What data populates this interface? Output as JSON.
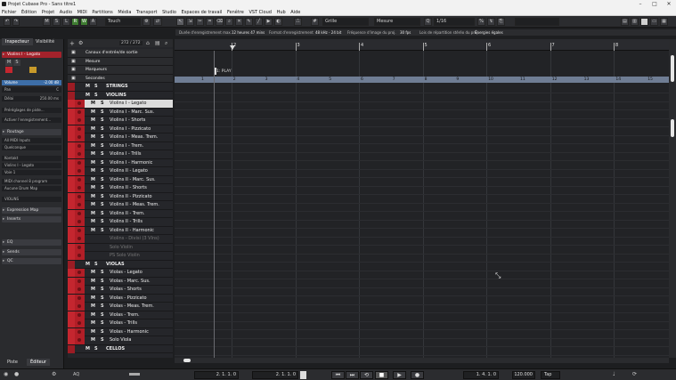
{
  "window": {
    "title": "Projet Cubase Pro - Sans titre1"
  },
  "menu": [
    "Fichier",
    "Édition",
    "Projet",
    "Audio",
    "MIDI",
    "Partitions",
    "Média",
    "Transport",
    "Studio",
    "Espaces de travail",
    "Fenêtre",
    "VST Cloud",
    "Hub",
    "Aide"
  ],
  "toolbar": {
    "m": "M",
    "s": "S",
    "l": "L",
    "r": "R",
    "w": "W",
    "a": "A",
    "touch": "Touch",
    "grid_label": "Grille",
    "grid_type": "Mesure",
    "quantize": "1/16"
  },
  "info": [
    {
      "label": "Durée d'enregistrement max.",
      "value": "12 heures 47 mins"
    },
    {
      "label": "Format d'enregistrement",
      "value": "48 kHz - 24 bit"
    },
    {
      "label": "Fréquence d'image du proj.",
      "value": "30 fps"
    },
    {
      "label": "Lois de répartition stéréo du proj.",
      "value": "Énergies égales"
    }
  ],
  "inspector": {
    "tab_inspector": "Inspecteur",
    "tab_visibility": "Visibilité",
    "track_name": "Violins I - Legato",
    "volume_label": "Volume",
    "volume_value": "-2.00 dB",
    "pan_label": "Pan",
    "pan_value": "C",
    "delay_label": "Délai",
    "delay_value": "250.00 ms",
    "preset_label": "Préréglages de piste...",
    "activate_label": "Activer l'enregistrement...",
    "routing": "Routage",
    "midi_in": "All MIDI Inputs",
    "any": "Quelconque",
    "kontakt": "Kontakt",
    "out": "Violins I - Legato",
    "chan": "Voie 1",
    "midi_channel": "MIDI channel 8 program",
    "drum_map": "Aucune Drum Map",
    "folder": "VIOLINS",
    "expression_map": "Expression Map",
    "inserts": "Inserts",
    "eq": "EQ",
    "sends": "Sends",
    "qc": "QC",
    "bottom_tab1": "Piste",
    "bottom_tab2": "Éditeur"
  },
  "track_panel": {
    "count": "272 / 272"
  },
  "tracks": [
    {
      "name": "Canaux d'entrée/de sortie",
      "type": "special"
    },
    {
      "name": "Mesure",
      "type": "special"
    },
    {
      "name": "Marqueurs",
      "type": "special"
    },
    {
      "name": "Secondes",
      "type": "special"
    },
    {
      "name": "STRINGS",
      "type": "folder"
    },
    {
      "name": "VIOLINS",
      "type": "folder"
    },
    {
      "name": "Violins I - Legato",
      "type": "sel"
    },
    {
      "name": "Violins I - Marc. Sus.",
      "type": "track"
    },
    {
      "name": "Violins I - Shorts",
      "type": "track"
    },
    {
      "name": "Violins I - Pizzicato",
      "type": "track"
    },
    {
      "name": "Violins I - Meas. Trem.",
      "type": "track"
    },
    {
      "name": "Violins I - Trem.",
      "type": "track"
    },
    {
      "name": "Violins I - Trills",
      "type": "track"
    },
    {
      "name": "Violins I - Harmonic",
      "type": "track"
    },
    {
      "name": "Violins II - Legato",
      "type": "track"
    },
    {
      "name": "Violins II - Marc. Sus.",
      "type": "track"
    },
    {
      "name": "Violins II - Shorts",
      "type": "track"
    },
    {
      "name": "Violins II - Pizzicato",
      "type": "track"
    },
    {
      "name": "Violins II - Meas. Trem.",
      "type": "track"
    },
    {
      "name": "Violins II - Trem.",
      "type": "track"
    },
    {
      "name": "Violins II - Trills",
      "type": "track"
    },
    {
      "name": "Violins II - Harmonic",
      "type": "track"
    },
    {
      "name": "Violins - Divisi (3 Vlns)",
      "type": "disabled"
    },
    {
      "name": "Solo Violin",
      "type": "disabled"
    },
    {
      "name": "PS Solo Violin",
      "type": "disabled"
    },
    {
      "name": "VIOLAS",
      "type": "folder"
    },
    {
      "name": "Violas - Legato",
      "type": "track"
    },
    {
      "name": "Violas - Marc. Sus.",
      "type": "track"
    },
    {
      "name": "Violas - Shorts",
      "type": "track"
    },
    {
      "name": "Violas - Pizzicato",
      "type": "track"
    },
    {
      "name": "Violas - Meas. Trem.",
      "type": "track"
    },
    {
      "name": "Violas - Trem.",
      "type": "track"
    },
    {
      "name": "Violas - Trills",
      "type": "track"
    },
    {
      "name": "Violas - Harmonic",
      "type": "track"
    },
    {
      "name": "Solo Viola",
      "type": "track"
    },
    {
      "name": "CELLOS",
      "type": "folder"
    }
  ],
  "ruler": {
    "bars": [
      "1",
      "2",
      "3",
      "4",
      "5",
      "6",
      "7",
      "8"
    ],
    "marker": "1: PLAY",
    "seconds": [
      "1",
      "2",
      "3",
      "4",
      "5",
      "6",
      "7",
      "8",
      "9",
      "10",
      "11",
      "12",
      "13",
      "14",
      "15"
    ]
  },
  "transport": {
    "left_locator": "2. 1. 1. 0",
    "right_locator": "2. 1. 1. 0",
    "position": "1. 4. 1. 0",
    "tempo": "120.000",
    "tap": "Tap",
    "aq": "AQ"
  }
}
